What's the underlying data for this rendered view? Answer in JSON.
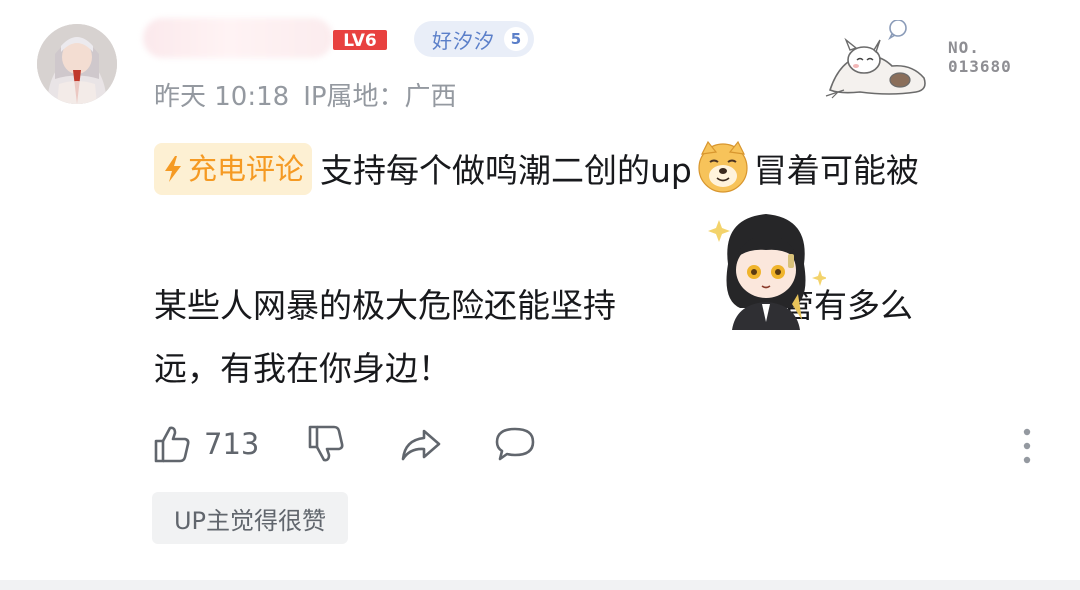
{
  "comment": {
    "level_text": "LV6",
    "fan_badge": {
      "name": "好汐汐",
      "level": "5"
    },
    "time": "昨天 10:18",
    "ip_location": "IP属地：广西",
    "number_label": "NO.",
    "number_value": "013680",
    "charge_tag": "充电评论",
    "content_line1": "支持每个做鸣潮二创的up",
    "content_line1_end": "冒着可能被",
    "content_line2": "某些人网暴的极大危险还能坚持",
    "content_line2_end": "不管有多么",
    "content_line3": "远，有我在你身边！",
    "like_count": "713",
    "up_liked_tag": "UP主觉得很赞"
  },
  "icons": {
    "avatar": "user-avatar",
    "like": "thumbs-up-icon",
    "dislike": "thumbs-down-icon",
    "share": "share-icon",
    "reply": "comment-bubble-icon",
    "more": "more-vertical-icon",
    "dog_emoji": "doge-emoji-icon",
    "sticker": "anime-girl-sticker",
    "mascot": "sleeping-mascot-decoration",
    "charge": "lightning-bolt-icon"
  },
  "colors": {
    "charge_accent": "#f59a23",
    "charge_bg": "#fdf0d3",
    "fan_badge": "#5b7fc9",
    "level_red": "#e8413f",
    "muted_text": "#9499a0"
  }
}
